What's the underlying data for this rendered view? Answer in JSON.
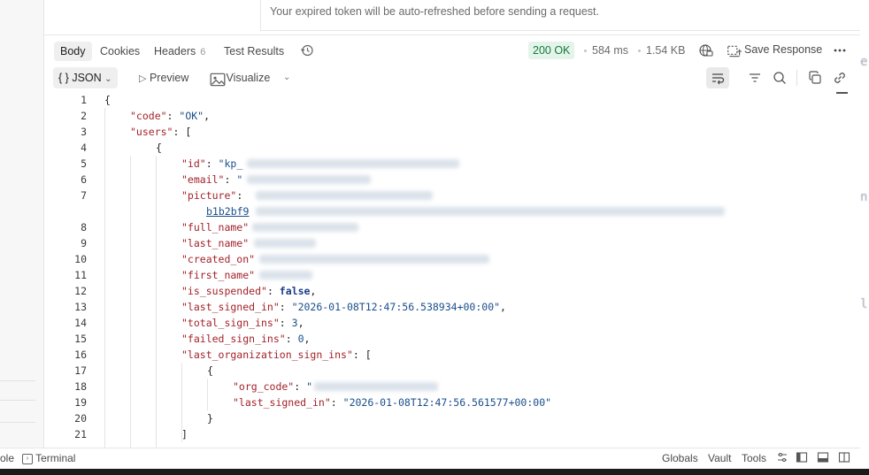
{
  "banner": {
    "message": "Your expired token will be auto-refreshed before sending a request."
  },
  "response_tabs": {
    "body": "Body",
    "cookies": "Cookies",
    "headers": "Headers",
    "headers_count": "6",
    "test_results": "Test Results"
  },
  "response_meta": {
    "status": "200 OK",
    "time": "584 ms",
    "size": "1.54 KB",
    "save_response": "Save Response"
  },
  "body_toolbar": {
    "format": "JSON",
    "format_icon": "{ }",
    "preview": "Preview",
    "visualize": "Visualize"
  },
  "editor": {
    "lines": [
      {
        "n": "1",
        "tokens": [
          {
            "t": "{",
            "c": "p"
          }
        ]
      },
      {
        "n": "2",
        "tokens": [
          {
            "t": "\"code\"",
            "c": "k"
          },
          {
            "t": ": ",
            "c": "p"
          },
          {
            "t": "\"OK\"",
            "c": "s"
          },
          {
            "t": ",",
            "c": "p"
          }
        ]
      },
      {
        "n": "3",
        "tokens": [
          {
            "t": "\"users\"",
            "c": "k"
          },
          {
            "t": ": [",
            "c": "p"
          }
        ]
      },
      {
        "n": "4",
        "tokens": [
          {
            "t": "{",
            "c": "p"
          }
        ]
      },
      {
        "n": "5",
        "tokens": [
          {
            "t": "\"id\"",
            "c": "k"
          },
          {
            "t": ": ",
            "c": "p"
          },
          {
            "t": "\"kp_",
            "c": "s"
          }
        ]
      },
      {
        "n": "6",
        "tokens": [
          {
            "t": "\"email\"",
            "c": "k"
          },
          {
            "t": ": ",
            "c": "p"
          },
          {
            "t": "\"",
            "c": "s"
          }
        ]
      },
      {
        "n": "7",
        "tokens": [
          {
            "t": "\"picture\"",
            "c": "k"
          },
          {
            "t": ": ",
            "c": "p"
          }
        ]
      },
      {
        "n": "",
        "tokens": [
          {
            "t": "b1b2bf9",
            "c": "link"
          }
        ]
      },
      {
        "n": "8",
        "tokens": [
          {
            "t": "\"full_name\"",
            "c": "k"
          }
        ]
      },
      {
        "n": "9",
        "tokens": [
          {
            "t": "\"last_name\"",
            "c": "k"
          }
        ]
      },
      {
        "n": "10",
        "tokens": [
          {
            "t": "\"created_on\"",
            "c": "k"
          }
        ]
      },
      {
        "n": "11",
        "tokens": [
          {
            "t": "\"first_name\"",
            "c": "k"
          }
        ]
      },
      {
        "n": "12",
        "tokens": [
          {
            "t": "\"is_suspended\"",
            "c": "k"
          },
          {
            "t": ": ",
            "c": "p"
          },
          {
            "t": "false",
            "c": "b"
          },
          {
            "t": ",",
            "c": "p"
          }
        ]
      },
      {
        "n": "13",
        "tokens": [
          {
            "t": "\"last_signed_in\"",
            "c": "k"
          },
          {
            "t": ": ",
            "c": "p"
          },
          {
            "t": "\"2026-01-08T12:47:56.538934+00:00\"",
            "c": "s"
          },
          {
            "t": ",",
            "c": "p"
          }
        ]
      },
      {
        "n": "14",
        "tokens": [
          {
            "t": "\"total_sign_ins\"",
            "c": "k"
          },
          {
            "t": ": ",
            "c": "p"
          },
          {
            "t": "3",
            "c": "s"
          },
          {
            "t": ",",
            "c": "p"
          }
        ]
      },
      {
        "n": "15",
        "tokens": [
          {
            "t": "\"failed_sign_ins\"",
            "c": "k"
          },
          {
            "t": ": ",
            "c": "p"
          },
          {
            "t": "0",
            "c": "s"
          },
          {
            "t": ",",
            "c": "p"
          }
        ]
      },
      {
        "n": "16",
        "tokens": [
          {
            "t": "\"last_organization_sign_ins\"",
            "c": "k"
          },
          {
            "t": ": [",
            "c": "p"
          }
        ]
      },
      {
        "n": "17",
        "tokens": [
          {
            "t": "{",
            "c": "p"
          }
        ]
      },
      {
        "n": "18",
        "tokens": [
          {
            "t": "\"org_code\"",
            "c": "k"
          },
          {
            "t": ": ",
            "c": "p"
          },
          {
            "t": "\"",
            "c": "s"
          }
        ]
      },
      {
        "n": "19",
        "tokens": [
          {
            "t": "\"last_signed_in\"",
            "c": "k"
          },
          {
            "t": ": ",
            "c": "p"
          },
          {
            "t": "\"2026-01-08T12:47:56.561577+00:00\"",
            "c": "s"
          }
        ]
      },
      {
        "n": "20",
        "tokens": [
          {
            "t": "}",
            "c": "p"
          }
        ]
      },
      {
        "n": "21",
        "tokens": [
          {
            "t": "]",
            "c": "p"
          }
        ]
      }
    ]
  },
  "statusbar": {
    "left_partial": "ole",
    "terminal": "Terminal",
    "globals": "Globals",
    "vault": "Vault",
    "tools": "Tools"
  },
  "colors": {
    "status_ok_bg": "#e5f4ea",
    "status_ok_text": "#137a3c",
    "json_key": "#a3232a",
    "json_string": "#1a4e8c"
  }
}
